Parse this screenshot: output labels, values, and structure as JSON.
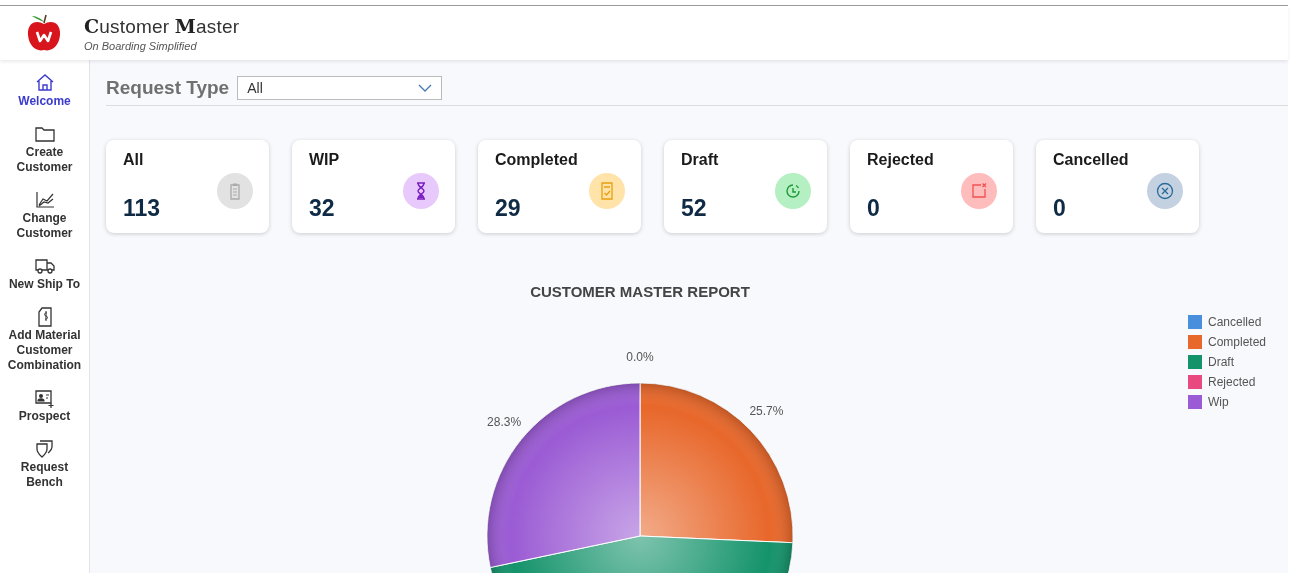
{
  "header": {
    "title": "**C**ustomer **M**aster",
    "subtitle": "On Boarding Simplified"
  },
  "sidebar": {
    "items": [
      {
        "label": "Welcome",
        "selected": true
      },
      {
        "label": "Create Customer",
        "selected": false
      },
      {
        "label": "Change Customer",
        "selected": false
      },
      {
        "label": "New Ship To",
        "selected": false
      },
      {
        "label": "Add Material Customer Combination",
        "selected": false
      },
      {
        "label": "Prospect",
        "selected": false
      },
      {
        "label": "Request Bench",
        "selected": false
      }
    ]
  },
  "filter": {
    "label": "Request Type",
    "value": "All"
  },
  "cards": [
    {
      "label": "All",
      "count": "113"
    },
    {
      "label": "WIP",
      "count": "32"
    },
    {
      "label": "Completed",
      "count": "29"
    },
    {
      "label": "Draft",
      "count": "52"
    },
    {
      "label": "Rejected",
      "count": "0"
    },
    {
      "label": "Cancelled",
      "count": "0"
    }
  ],
  "chart_data": {
    "type": "pie",
    "title": "CUSTOMER MASTER REPORT",
    "categories": [
      "Cancelled",
      "Completed",
      "Draft",
      "Rejected",
      "Wip"
    ],
    "values": [
      0,
      25.7,
      46.0,
      0,
      28.3
    ],
    "colors": [
      "#4a8fdc",
      "#e8672a",
      "#14936a",
      "#e84a7f",
      "#9b5bd4"
    ],
    "value_labels": [
      "0.0%",
      "25.7%",
      null,
      null,
      "28.3%"
    ]
  }
}
